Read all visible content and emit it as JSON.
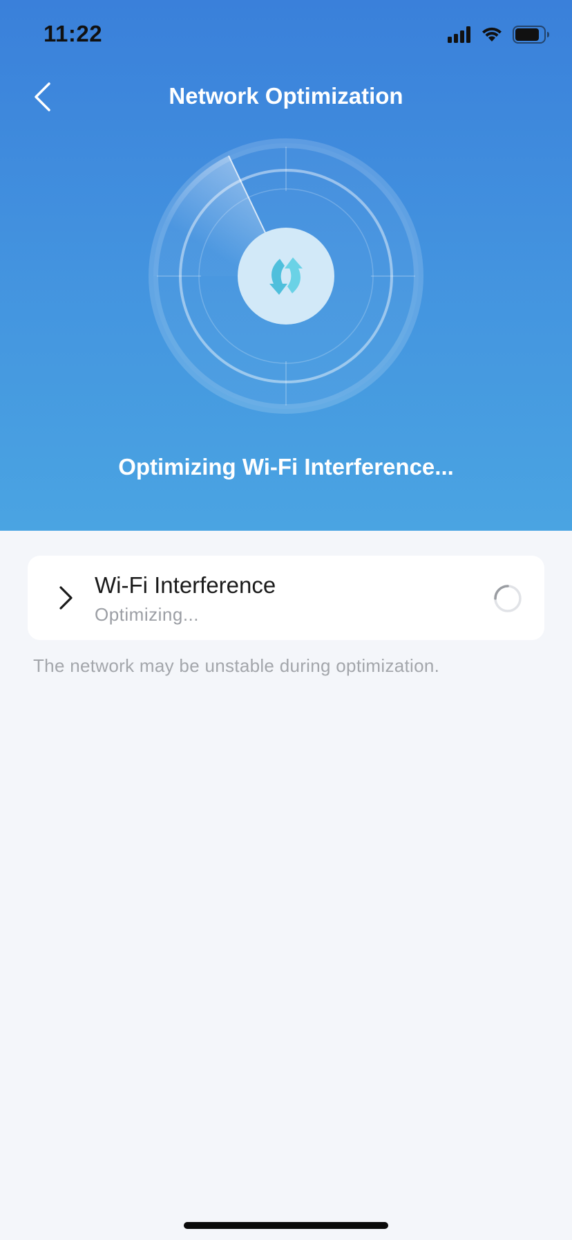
{
  "status_bar": {
    "time": "11:22",
    "icons": [
      "signal-icon",
      "wifi-icon",
      "battery-icon"
    ]
  },
  "header": {
    "title": "Network Optimization",
    "back_icon": "chevron-left-icon"
  },
  "radar": {
    "center_icon": "refresh-arrows-icon"
  },
  "status_message": "Optimizing Wi-Fi Interference...",
  "tasks": [
    {
      "name": "Wi-Fi Interference",
      "status": "Optimizing...",
      "expand_icon": "chevron-right-icon",
      "progress_icon": "spinner-icon"
    }
  ],
  "notice": "The network may be unstable during optimization.",
  "colors": {
    "header_gradient_top": "#3a80da",
    "header_gradient_bottom": "#4aa4e2",
    "page_background": "#f4f6fa",
    "card_background": "#ffffff",
    "accent_cyan": "#5cc8e0"
  }
}
